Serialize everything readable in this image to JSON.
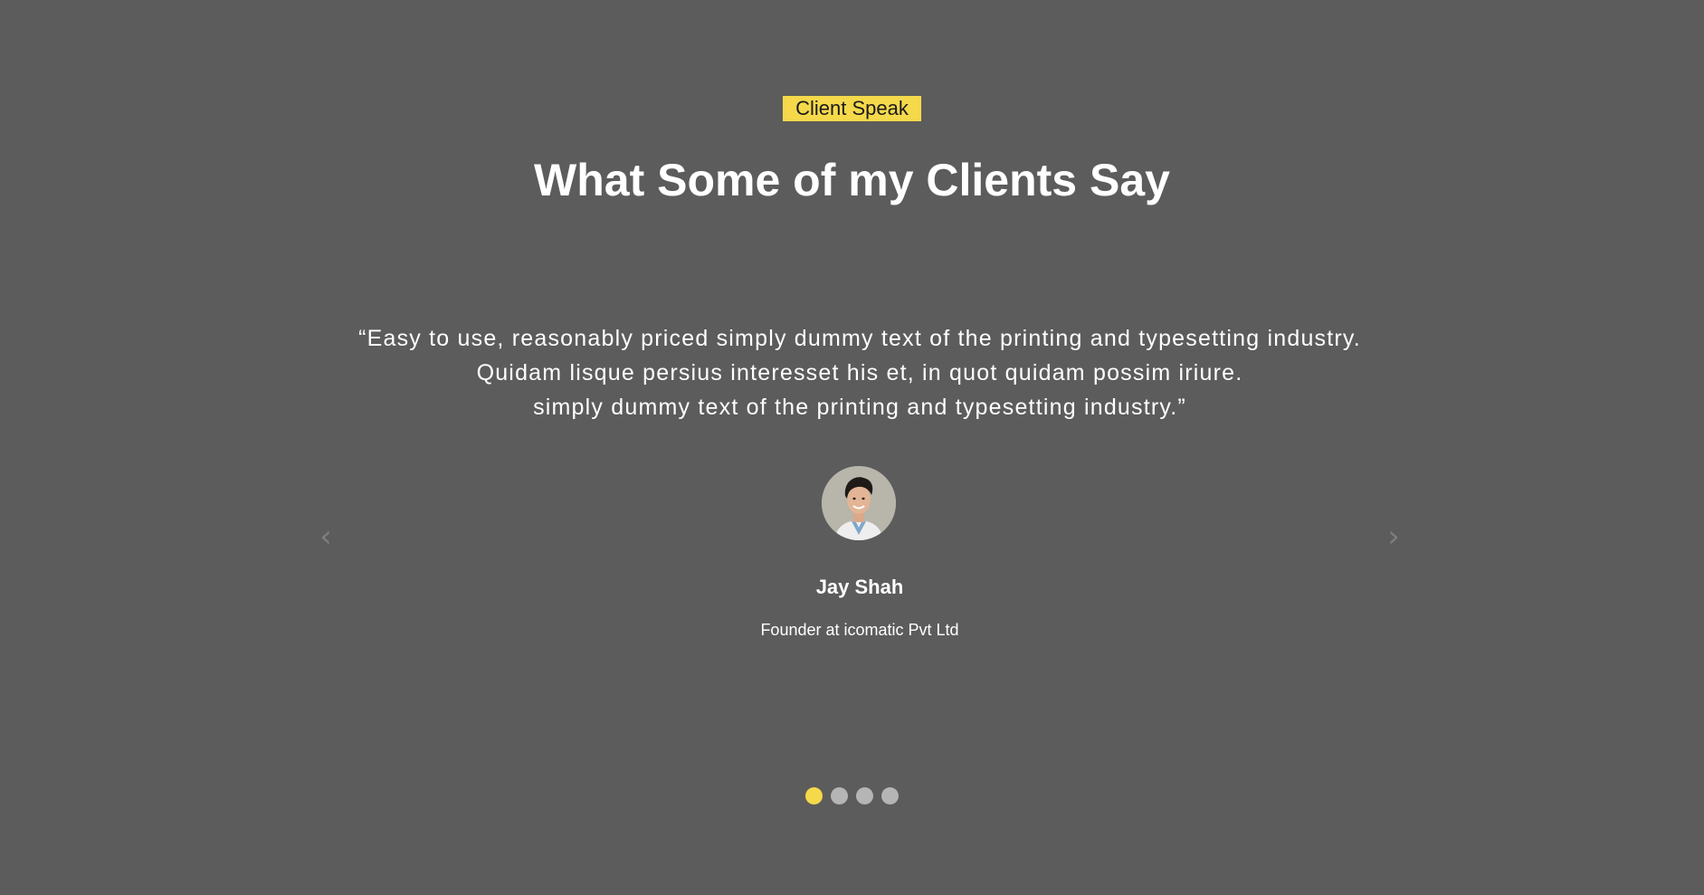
{
  "section": {
    "tag": "Client Speak",
    "title": "What Some of my Clients Say"
  },
  "testimonial": {
    "quote_lines": [
      "“Easy to use, reasonably priced simply dummy text of the printing and typesetting industry.",
      "Quidam lisque persius interesset his et, in quot quidam possim iriure.",
      "simply dummy text of the printing and typesetting industry.”"
    ],
    "name": "Jay Shah",
    "role": "Founder at icomatic Pvt Ltd",
    "avatar_icon": "client-photo"
  },
  "navigation": {
    "prev_label": "‹",
    "next_label": "›"
  },
  "pagination": {
    "count": 4,
    "active_index": 0
  },
  "colors": {
    "background": "#5c5c5c",
    "accent": "#f5d94b",
    "dot_inactive": "#b5b5b5",
    "arrow": "#7d7d7d"
  }
}
